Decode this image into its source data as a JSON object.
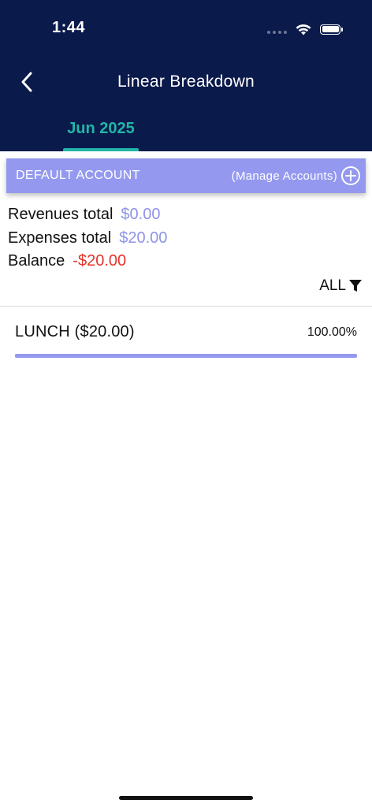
{
  "status_bar": {
    "time": "1:44"
  },
  "nav": {
    "title": "Linear Breakdown",
    "back_icon": "chevron-left-icon"
  },
  "period": {
    "tab_label": "Jun 2025",
    "accent_color": "#22b5a7"
  },
  "account": {
    "name": "DEFAULT ACCOUNT",
    "manage_label": "(Manage Accounts)",
    "manage_icon": "plus-circle-icon",
    "bar_color": "#9499ef"
  },
  "totals": {
    "revenues_label": "Revenues total",
    "revenues_value": "$0.00",
    "expenses_label": "Expenses total",
    "expenses_value": "$20.00",
    "balance_label": "Balance",
    "balance_value": "-$20.00"
  },
  "filter": {
    "label": "ALL",
    "icon": "filter-icon"
  },
  "breakdown": {
    "items": [
      {
        "label": "LUNCH ($20.00)",
        "percent": "100.00%",
        "fraction": 1.0
      }
    ]
  },
  "colors": {
    "header_bg": "#0a1a4b",
    "positive_value": "#8e93e6",
    "negative_value": "#e5332a"
  }
}
